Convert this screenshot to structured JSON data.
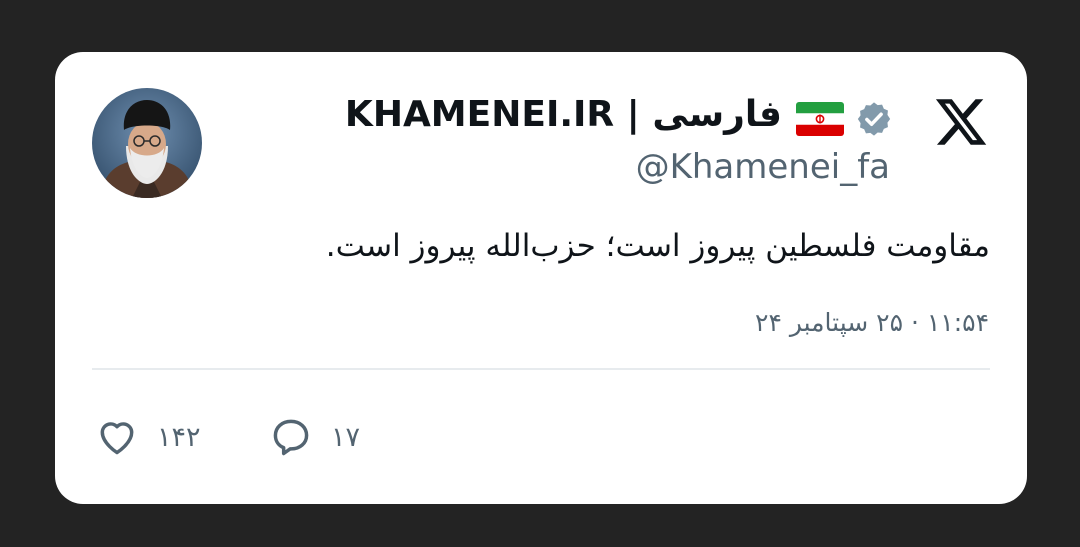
{
  "tweet": {
    "display_name": "KHAMENEI.IR | فارسی",
    "handle": "@Khamenei_fa",
    "text": "مقاومت فلسطین پیروز است؛ حزب‌الله پیروز است.",
    "timestamp": "۱۱:۵۴ · ۲۵ سپتامبر ۲۴",
    "verified": true,
    "flag": "iran-flag"
  },
  "actions": {
    "likes_count": "۱۴۲",
    "replies_count": "۱۷"
  },
  "icons": {
    "logo": "x-logo-icon",
    "verified": "verified-badge-icon",
    "like": "heart-icon",
    "reply": "reply-icon"
  },
  "colors": {
    "background": "#232323",
    "card": "#ffffff",
    "primary_text": "#0f1419",
    "secondary_text": "#536471",
    "verified": "#829aab",
    "divider": "#e7ebee"
  }
}
